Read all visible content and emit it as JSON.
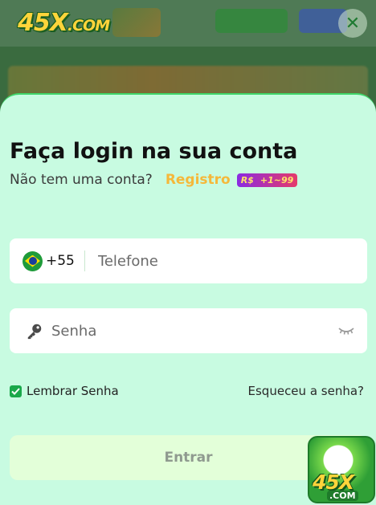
{
  "header": {
    "logo_main": "45X",
    "logo_suffix": ".COM"
  },
  "modal": {
    "close_symbol": "✕",
    "title": "Faça login na sua conta",
    "subtitle": "Não tem uma conta?",
    "register_link": "Registro",
    "badge_currency": "R$",
    "badge_amount": "+1~99",
    "phone": {
      "country_code": "+55",
      "placeholder": "Telefone",
      "flag_icon": "brazil-flag-icon"
    },
    "password": {
      "placeholder": "Senha",
      "lead_icon": "key-icon",
      "toggle_icon": "eye-closed-icon"
    },
    "remember_label": "Lembrar Senha",
    "remember_checked": true,
    "forgot_link": "Esqueceu a senha?",
    "submit_label": "Entrar"
  },
  "floating_ad": {
    "logo_main": "45X",
    "logo_suffix": ".COM"
  },
  "colors": {
    "panel_bg": "#c8fbe1",
    "accent_green": "#1aa84a",
    "register_color": "#f5b83a",
    "submit_bg": "#e3ffd9"
  }
}
